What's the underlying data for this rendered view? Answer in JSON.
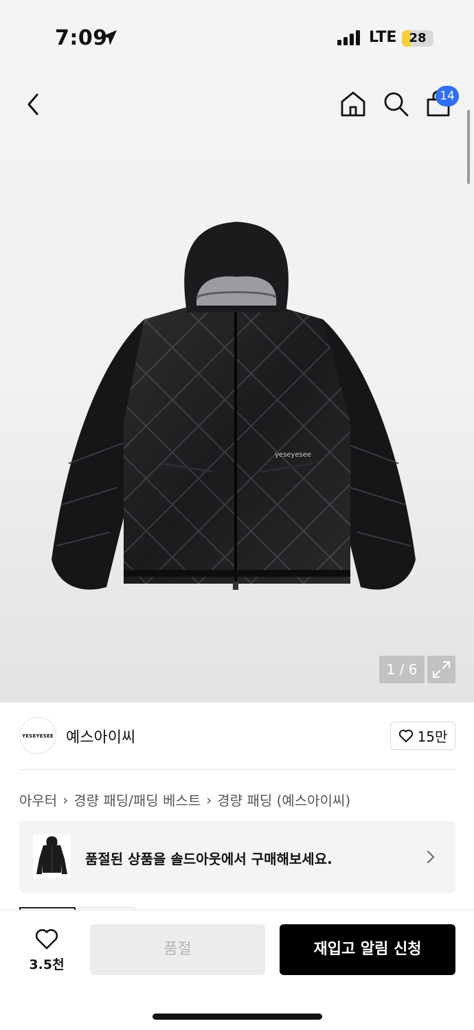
{
  "status_bar": {
    "time": "7:09",
    "network": "LTE",
    "battery": "28",
    "battery_level_percent": 28
  },
  "nav": {
    "cart_count": "14",
    "icons": [
      "back-icon",
      "home-icon",
      "search-icon",
      "shopping-bag-icon"
    ]
  },
  "product_image": {
    "counter": "1 / 6",
    "brand_patch": "yeseyesee"
  },
  "brand": {
    "logo_text": "YESEYESEE",
    "name": "예스아이씨",
    "likes": "15만"
  },
  "breadcrumb": {
    "items": [
      "아우터",
      "경량 패딩/패딩 베스트",
      "경량 패딩 (예스아이씨)"
    ]
  },
  "soldout_banner": {
    "text": "품절된 상품을 솔드아웃에서 구매해보세요."
  },
  "bottom_bar": {
    "wish_count": "3.5천",
    "soldout_label": "품절",
    "restock_label": "재입고 알림 신청"
  },
  "colors": {
    "badge": "#2f6ff5",
    "primary_button": "#000000",
    "disabled_button": "#ececec",
    "battery": "#f7cd3d"
  }
}
